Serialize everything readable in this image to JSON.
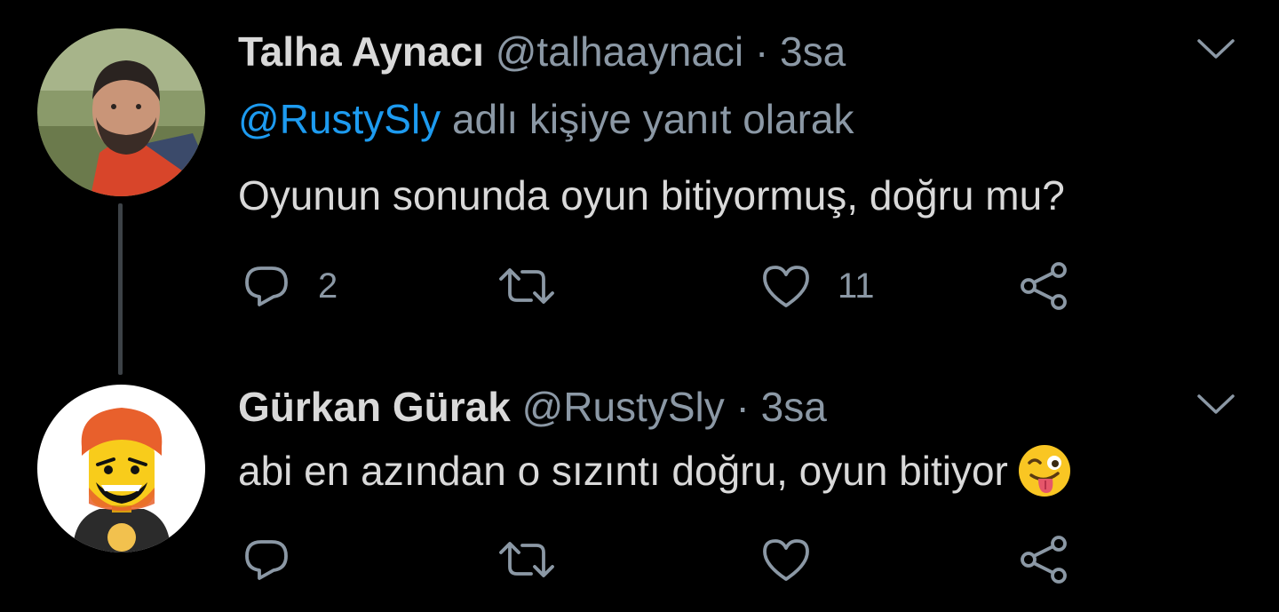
{
  "tweets": [
    {
      "name": "Talha Aynacı",
      "handle": "@talhaaynaci",
      "separator": "·",
      "time": "3sa",
      "reply_to": {
        "mention": "@RustySly",
        "suffix": "adlı kişiye yanıt olarak"
      },
      "text": "Oyunun sonunda oyun bitiyormuş, doğru mu?",
      "stats": {
        "replies": "2",
        "likes": "11"
      },
      "avatar_icon": "person-photo-avatar"
    },
    {
      "name": "Gürkan Gürak",
      "handle": "@RustySly",
      "separator": "·",
      "time": "3sa",
      "text": "abi en azından o sızıntı doğru, oyun bitiyor",
      "emoji": "winking-face-with-tongue-emoji",
      "avatar_icon": "lego-figure-avatar"
    }
  ],
  "icons": {
    "reply": "reply-icon",
    "retweet": "retweet-icon",
    "like": "heart-icon",
    "share": "share-icon",
    "more": "chevron-down-icon"
  },
  "colors": {
    "background": "#000000",
    "text": "#d9d9d9",
    "secondary": "#8b98a5",
    "mention": "#1d9bf0",
    "thread_line": "#3d4247"
  }
}
